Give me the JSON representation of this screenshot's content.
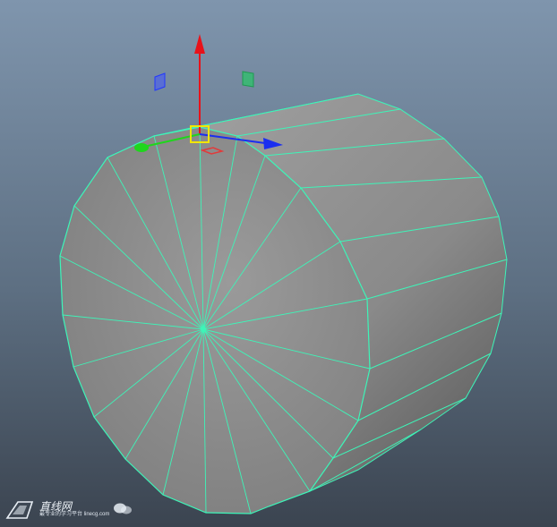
{
  "viewport": {
    "type": "3d-perspective-view",
    "background_top": "#7f95ad",
    "background_bottom": "#3b4450"
  },
  "object": {
    "type": "polygon-cylinder",
    "fill": "#8e8e8e",
    "wireframe_color": "#3df5b8",
    "cap_segments": 20,
    "side_segments": 20
  },
  "manipulator": {
    "y_axis_color": "#e8121a",
    "x_axis_color": "#1a2ef0",
    "z_axis_color": "#1fd61c",
    "center_handle_color": "#f1e600",
    "plane_handle_xy_color": "#2237ff",
    "plane_handle_yz_color": "#2ec26a",
    "plane_handle_xz_color": "#e23a3a"
  },
  "watermark": {
    "name": "直线网",
    "subtitle": "最专业的学习平台 linecg.com",
    "icon": "speech-bubbles-icon"
  }
}
